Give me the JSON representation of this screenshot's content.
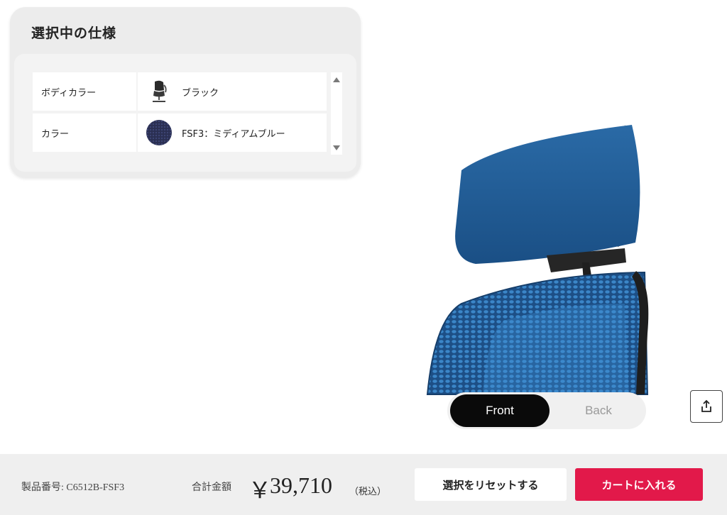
{
  "spec_panel": {
    "title": "選択中の仕様",
    "rows": [
      {
        "label": "ボディカラー",
        "value": "ブラック",
        "swatch": "chair-thumbnail-black"
      },
      {
        "label": "カラー",
        "value": "FSF3：ミディアムブルー",
        "swatch": "fabric-swatch-medium-blue"
      }
    ]
  },
  "viewer": {
    "front_label": "Front",
    "back_label": "Back",
    "active_view": "Front",
    "share_icon": "share-upload-icon"
  },
  "footer": {
    "product_code": "製品番号: C6512B-FSF3",
    "total_label": "合計金額",
    "currency_symbol": "￥",
    "price": "39,710",
    "tax_note": "（税込）",
    "reset_label": "選択をリセットする",
    "cart_label": "カートに入れる"
  },
  "colors": {
    "accent": "#e2194a",
    "fabric_blue": "#1f5b91",
    "frame_black": "#1a1a1a"
  }
}
